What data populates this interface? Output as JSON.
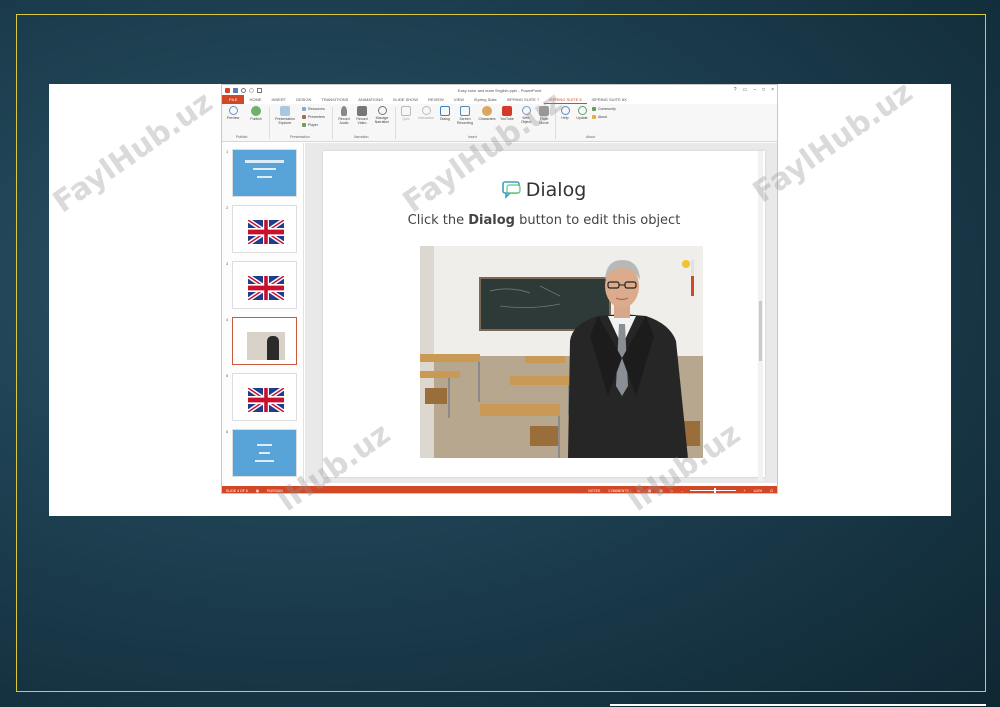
{
  "app": {
    "window_title": "Easy color and learn English.pptx - PowerPoint",
    "tabs": [
      "FILE",
      "HOME",
      "INSERT",
      "DESIGN",
      "TRANSITIONS",
      "ANIMATIONS",
      "SLIDE SHOW",
      "REVIEW",
      "VIEW",
      "iSpring Suite",
      "iSPRING SUITE 7",
      "iSPRING SUITE 8",
      "iSPRING SUITE 8X"
    ],
    "active_tab_index": 11
  },
  "ribbon": {
    "buttons": {
      "preview": "Preview",
      "publish": "Publish",
      "presentation_explorer": "Presentation Explorer",
      "resources": "Resources",
      "presenters": "Presenters",
      "player": "Player",
      "record_audio": "Record Audio",
      "record_video": "Record Video",
      "manage_narration": "Manage Narration",
      "quiz": "Quiz",
      "interaction": "Interaction",
      "dialog": "Dialog",
      "screen_recording": "Screen Recording",
      "characters": "Characters",
      "youtube": "YouTube",
      "web_object": "Web Object",
      "flash_movie": "Flash Movie",
      "help": "Help",
      "update": "Update",
      "community": "Community",
      "about": "About"
    },
    "groups": {
      "publish": "Publish",
      "presentation": "Presentation",
      "narration": "Narration",
      "insert": "Insert",
      "about": "About"
    }
  },
  "thumbnails": {
    "numbers": [
      "1",
      "2",
      "3",
      "4",
      "5",
      "6"
    ],
    "selected_index": 3
  },
  "slide": {
    "title": "Dialog",
    "subtitle_prefix": "Click the ",
    "subtitle_bold": "Dialog",
    "subtitle_suffix": " button to edit this object"
  },
  "status": {
    "slide_indicator": "SLIDE 4 OF 6",
    "language": "RUSSIAN",
    "notes": "NOTES",
    "comments": "COMMENTS",
    "zoom": "110%"
  },
  "watermarks": {
    "text_full": "FaylHub.uz",
    "text_partial": "lHub.uz"
  },
  "colors": {
    "accent": "#d24726",
    "frame": "#d8c93a",
    "thumb_blue": "#58a4d8"
  }
}
